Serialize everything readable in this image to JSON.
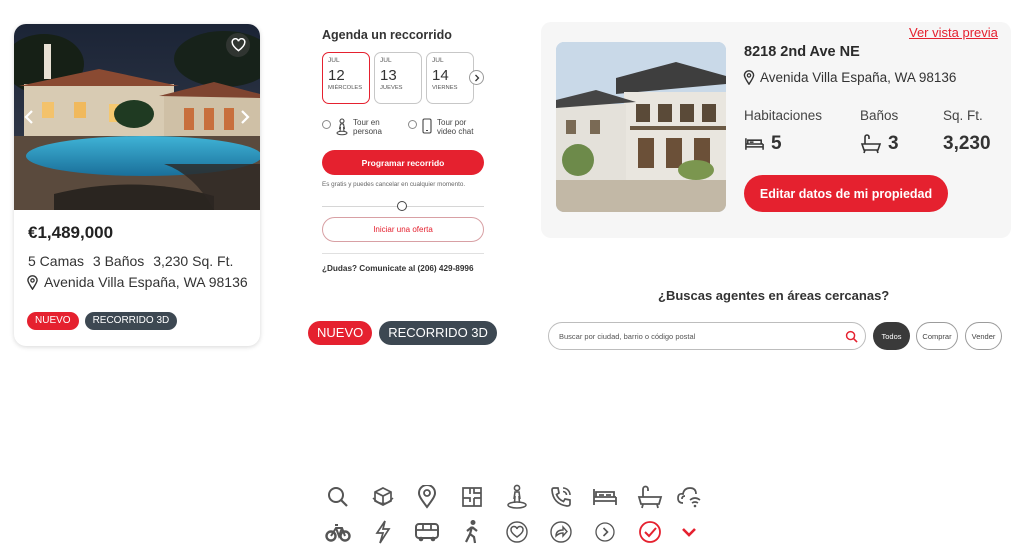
{
  "listing": {
    "price": "€1,489,000",
    "beds": "5 Camas",
    "baths": "3 Baños",
    "sqft": "3,230 Sq. Ft.",
    "address": "Avenida Villa España, WA 98136",
    "badges": [
      "NUEVO",
      "RECORRIDO 3D"
    ]
  },
  "tour": {
    "title": "Agenda un reccorrido",
    "days": [
      {
        "month": "JUL",
        "day": "12",
        "weekday": "MIÉRCOLES",
        "selected": true
      },
      {
        "month": "JUL",
        "day": "13",
        "weekday": "JUEVES",
        "selected": false
      },
      {
        "month": "JUL",
        "day": "14",
        "weekday": "VIERNES",
        "selected": false
      }
    ],
    "option_person": "Tour en persona",
    "option_video": "Tour por video chat",
    "schedule_button": "Programar recorrido",
    "free_note": "Es gratis y puedes cancelar en cualquier momento.",
    "offer_button": "Iniciar una oferta",
    "doubts": "¿Dudas? Comunicate al (206) 429-8996"
  },
  "badges_large": [
    "NUEVO",
    "RECORRIDO 3D"
  ],
  "property": {
    "preview_link": "Ver vista previa",
    "address": "8218 2nd Ave NE",
    "city": "Avenida Villa España, WA 98136",
    "rooms_label": "Habitaciones",
    "rooms_value": "5",
    "baths_label": "Baños",
    "baths_value": "3",
    "sqft_label": "Sq. Ft.",
    "sqft_value": "3,230",
    "edit_button": "Editar datos de mi propiedad"
  },
  "agents": {
    "title": "¿Buscas agentes en áreas cercanas?",
    "search_placeholder": "Buscar por ciudad, barrio o código postal",
    "chips": [
      "Todos",
      "Comprar",
      "Vender"
    ],
    "active_chip": "Todos"
  },
  "icon_set": [
    "search-icon",
    "cube-icon",
    "location-pin-icon",
    "floor-plan-icon",
    "person-pin-icon",
    "phone-ringing-icon",
    "bed-icon",
    "bathtub-icon",
    "cloud-wifi-icon",
    "bicycle-icon",
    "lightning-icon",
    "bus-icon",
    "walking-icon",
    "heart-circle-icon",
    "share-circle-icon",
    "chevron-right-circle-icon",
    "check-circle-icon",
    "chevron-down-icon"
  ],
  "colors": {
    "accent": "#e5212f",
    "dark_badge": "#3d4852",
    "text": "#333333"
  }
}
